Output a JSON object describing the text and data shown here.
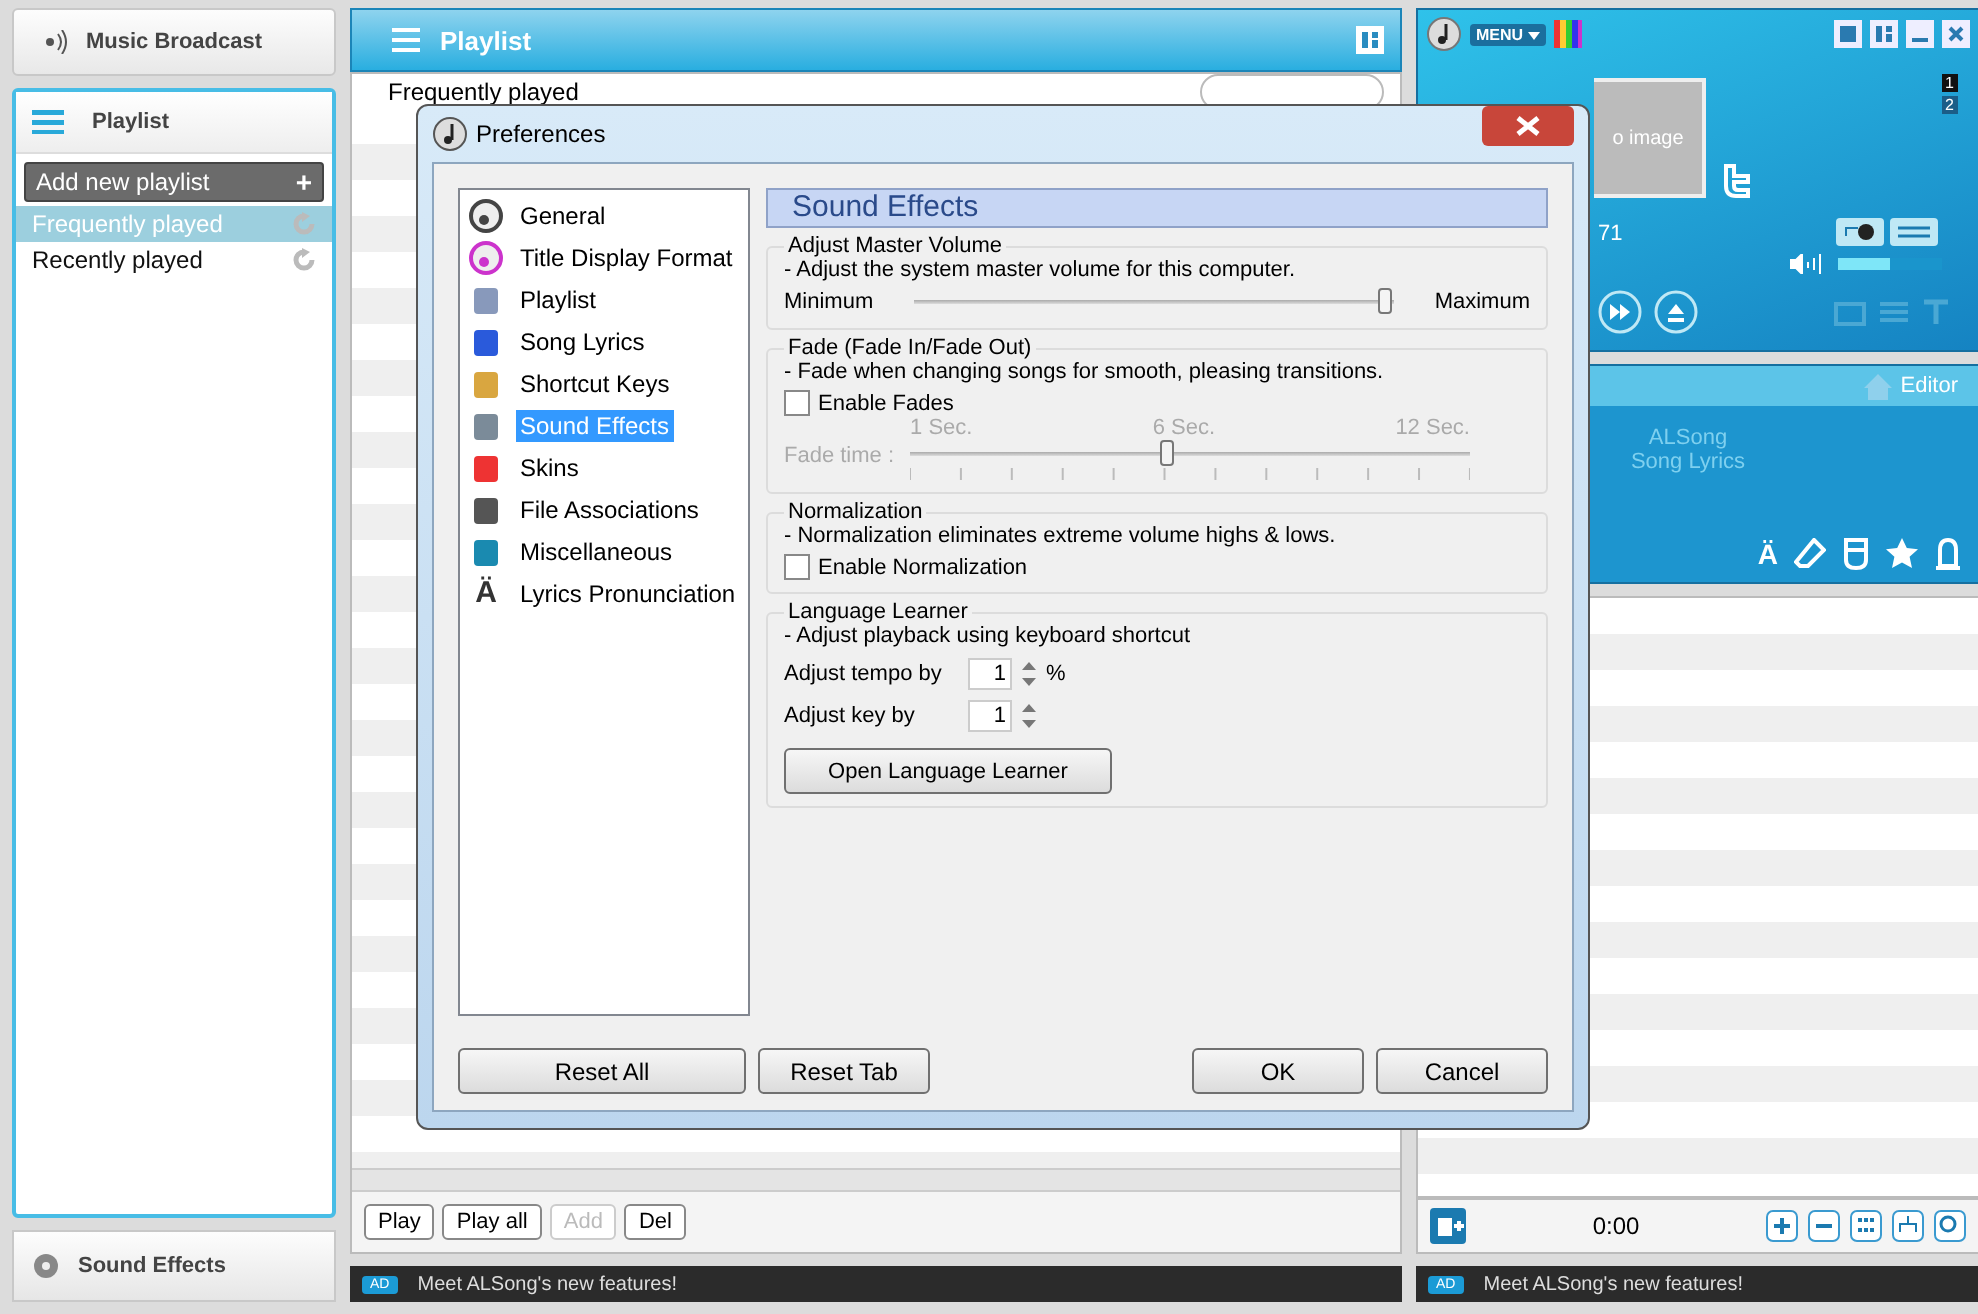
{
  "sidebar": {
    "broadcast": "Music Broadcast",
    "title": "Playlist",
    "add_button": {
      "label": "Add new playlist",
      "icon": "+"
    },
    "playlists": [
      {
        "name": "Frequently played",
        "selected": true
      },
      {
        "name": "Recently played",
        "selected": false
      }
    ],
    "footer": "Sound Effects"
  },
  "playlist_panel": {
    "title": "Playlist",
    "current": "Frequently played",
    "buttons": [
      {
        "label": "Play",
        "disabled": false
      },
      {
        "label": "Play all",
        "disabled": false
      },
      {
        "label": "Add",
        "disabled": true
      },
      {
        "label": "Del",
        "disabled": false
      }
    ],
    "ad": {
      "badge": "AD",
      "text": "Meet ALSong's new features!"
    }
  },
  "player": {
    "menu": "MENU",
    "pages": [
      "1",
      "2"
    ],
    "cover": "o image",
    "time": "71",
    "volume": {
      "level": 0.5
    },
    "lyrics": {
      "editor": "Editor",
      "lines": [
        "ALSong",
        "Song Lyrics"
      ],
      "tool_char": "Ä"
    },
    "clock": "0:00",
    "ad": {
      "badge": "AD",
      "text": "Meet ALSong's new features!"
    }
  },
  "dialog": {
    "title": "Preferences",
    "categories": [
      {
        "label": "General",
        "selected": false
      },
      {
        "label": "Title Display Format",
        "selected": false
      },
      {
        "label": "Playlist",
        "selected": false
      },
      {
        "label": "Song Lyrics",
        "selected": false
      },
      {
        "label": "Shortcut Keys",
        "selected": false
      },
      {
        "label": "Sound Effects",
        "selected": true
      },
      {
        "label": "Skins",
        "selected": false
      },
      {
        "label": "File Associations",
        "selected": false
      },
      {
        "label": "Miscellaneous",
        "selected": false
      },
      {
        "label": "Lyrics Pronunciation",
        "selected": false,
        "icon_char": "Ä"
      }
    ],
    "heading": "Sound Effects",
    "groups": [
      {
        "kind": "volume",
        "title": "Adjust Master Volume",
        "description": "- Adjust the system master volume for this computer.",
        "min_label": "Minimum",
        "max_label": "Maximum",
        "level": 0.98
      },
      {
        "kind": "fade",
        "title": "Fade (Fade In/Fade Out)",
        "description": "- Fade when changing songs for smooth, pleasing transitions.",
        "checkbox": {
          "label": "Enable Fades",
          "checked": false
        },
        "slider": {
          "label": "Fade time :",
          "ticks": [
            "1 Sec.",
            "6 Sec.",
            "12 Sec."
          ],
          "level": 0.46,
          "disabled": true
        }
      },
      {
        "kind": "toggle",
        "title": "Normalization",
        "description": "- Normalization eliminates extreme volume highs & lows.",
        "checkbox": {
          "label": "Enable Normalization",
          "checked": false
        }
      },
      {
        "kind": "learner",
        "title": "Language Learner",
        "description": "-  Adjust playback using keyboard shortcut",
        "spins": [
          {
            "label": "Adjust tempo by",
            "value": "1",
            "unit": "%"
          },
          {
            "label": "Adjust key by",
            "value": "1"
          }
        ],
        "button": "Open Language Learner"
      }
    ],
    "buttons_left": [
      "Reset All",
      "Reset Tab"
    ],
    "buttons_right": [
      "OK",
      "Cancel"
    ]
  }
}
